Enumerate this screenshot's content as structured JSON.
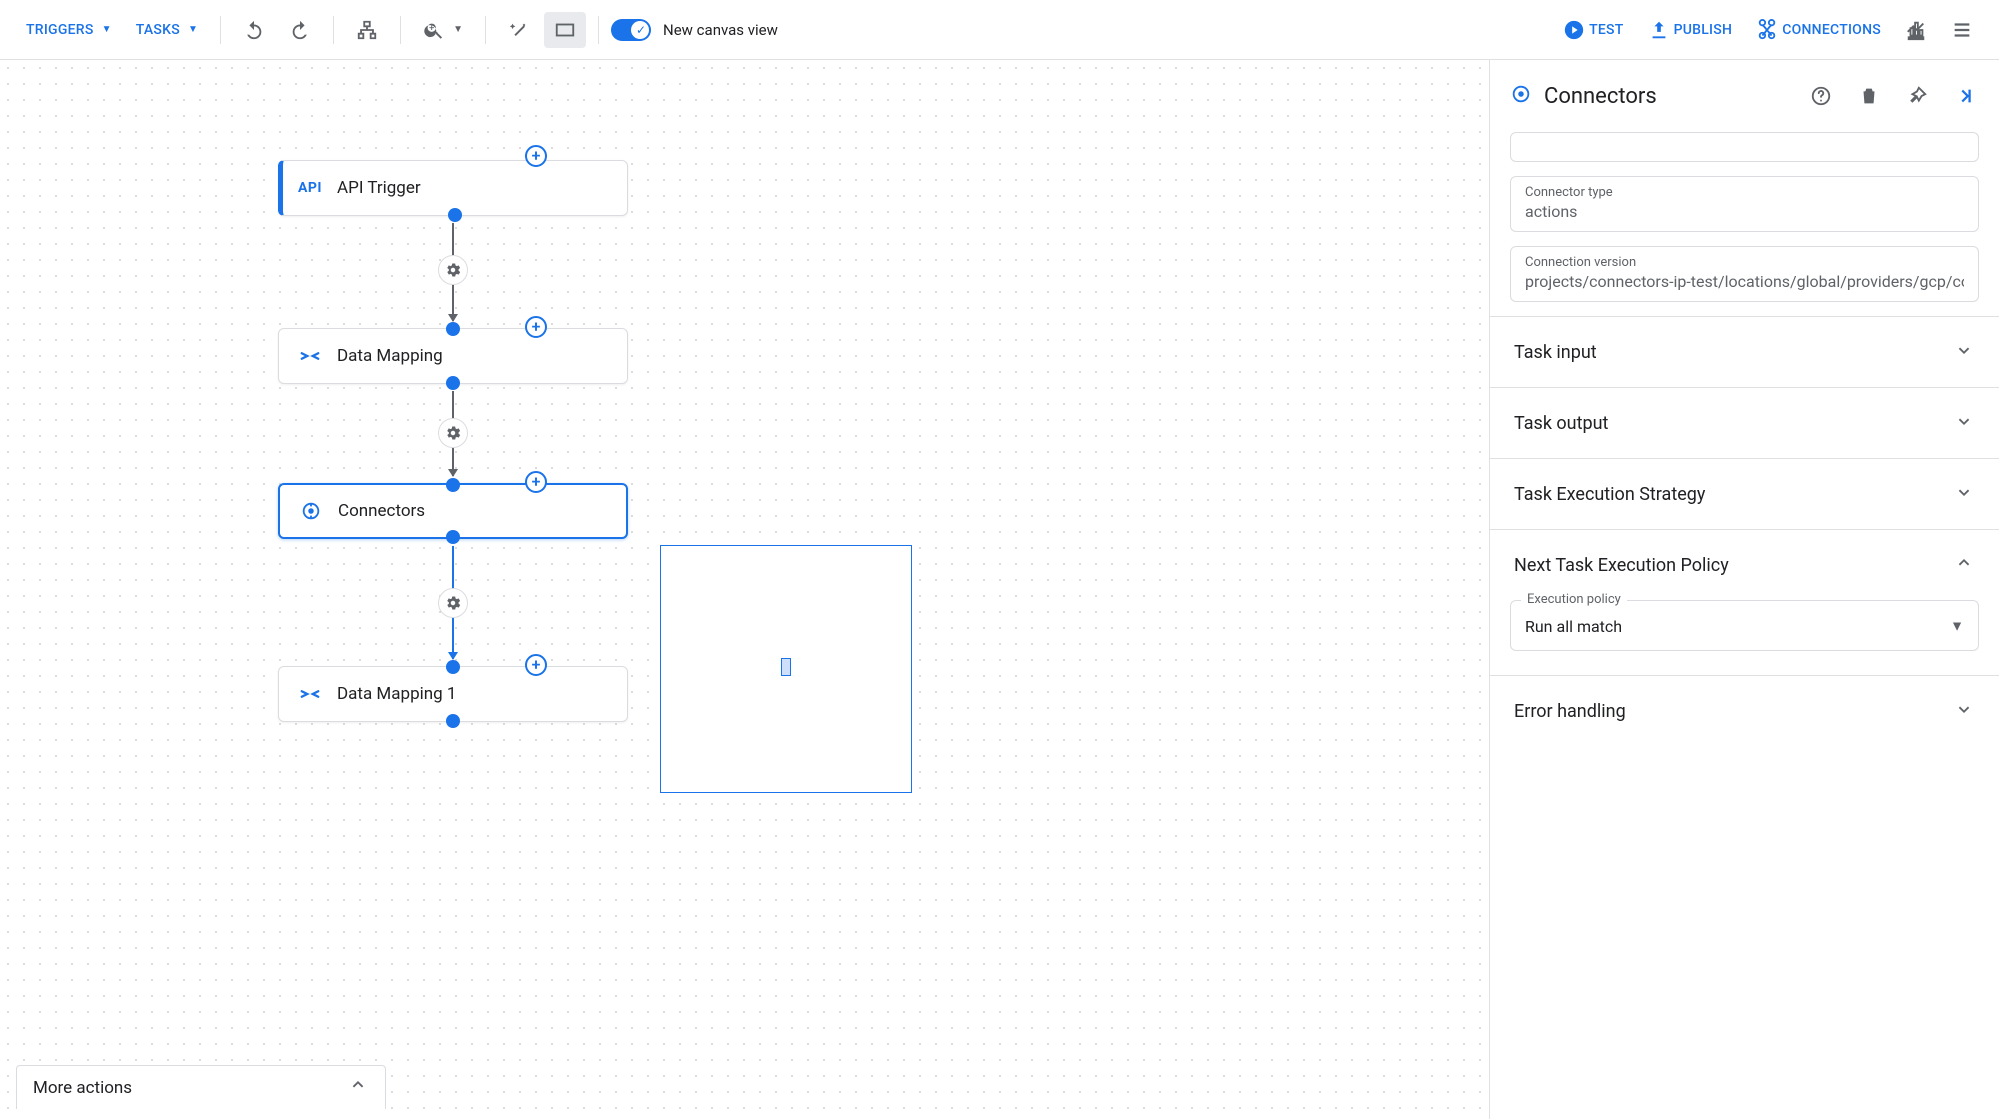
{
  "toolbar": {
    "triggers_label": "TRIGGERS",
    "tasks_label": "TASKS",
    "new_canvas_label": "New canvas view",
    "test_label": "TEST",
    "publish_label": "PUBLISH",
    "connections_label": "CONNECTIONS"
  },
  "nodes": [
    {
      "id": "api-trigger",
      "label": "API Trigger",
      "icon": "API",
      "accent": true
    },
    {
      "id": "data-mapping",
      "label": "Data Mapping",
      "icon": "mapping"
    },
    {
      "id": "connectors",
      "label": "Connectors",
      "icon": "connector",
      "selected": true
    },
    {
      "id": "data-mapping-1",
      "label": "Data Mapping 1",
      "icon": "mapping"
    }
  ],
  "side": {
    "title": "Connectors",
    "connector_type_label": "Connector type",
    "connector_type_value": "actions",
    "connection_version_label": "Connection version",
    "connection_version_value": "projects/connectors-ip-test/locations/global/providers/gcp/co",
    "sections": {
      "task_input": "Task input",
      "task_output": "Task output",
      "task_exec_strategy": "Task Execution Strategy",
      "next_task_policy": "Next Task Execution Policy",
      "error_handling": "Error handling"
    },
    "execution_policy_label": "Execution policy",
    "execution_policy_value": "Run all match"
  },
  "bottom_bar": {
    "label": "More actions"
  }
}
